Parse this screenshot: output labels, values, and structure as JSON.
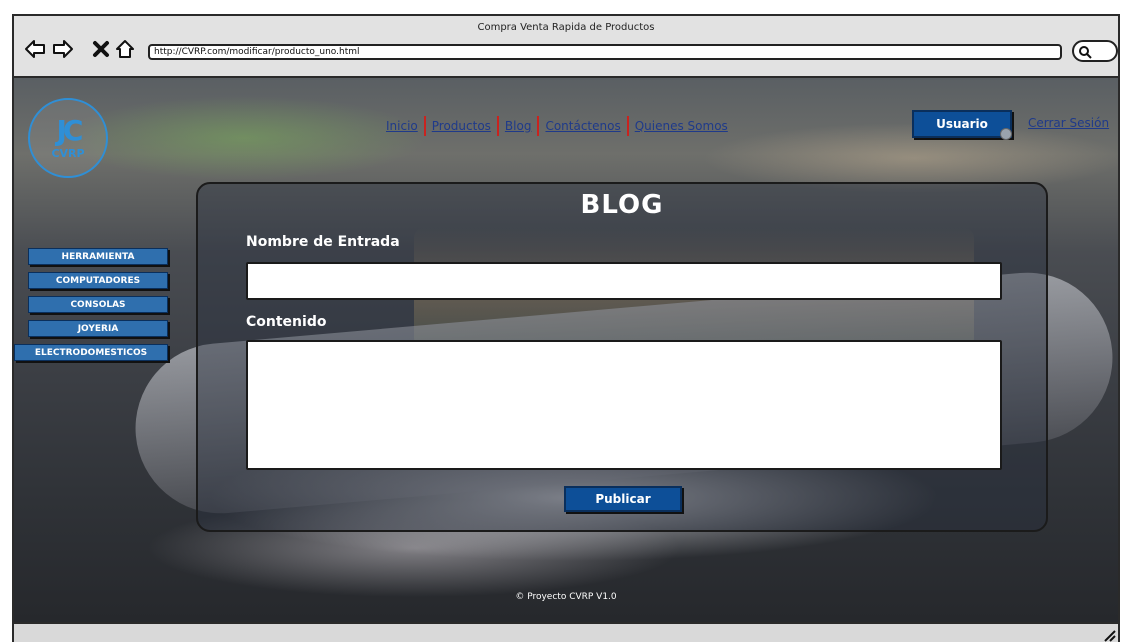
{
  "window": {
    "title": "Compra Venta Rapida de Productos",
    "url": "http://CVRP.com/modificar/producto_uno.html"
  },
  "icons": {
    "back": "arrow-left-icon",
    "forward": "arrow-right-icon",
    "stop": "close-icon",
    "home": "home-icon",
    "search": "search-icon"
  },
  "logo": {
    "mark": "JC",
    "text": "CVRP"
  },
  "nav": {
    "items": [
      {
        "label": "Inicio"
      },
      {
        "label": "Productos"
      },
      {
        "label": "Blog"
      },
      {
        "label": "Contáctenos"
      },
      {
        "label": "Quienes Somos"
      }
    ]
  },
  "user": {
    "button_label": "Usuario",
    "logout_label": "Cerrar Sesión"
  },
  "sidebar": {
    "items": [
      {
        "label": "HERRAMIENTA"
      },
      {
        "label": "COMPUTADORES"
      },
      {
        "label": "CONSOLAS"
      },
      {
        "label": "JOYERIA"
      },
      {
        "label": "ELECTRODOMESTICOS"
      }
    ]
  },
  "blog": {
    "title": "BLOG",
    "entry_name_label": "Nombre de Entrada",
    "entry_name_value": "",
    "content_label": "Contenido",
    "content_value": "",
    "publish_label": "Publicar"
  },
  "footer": {
    "text": "© Proyecto CVRP V1.0"
  },
  "colors": {
    "primary_button": "#0d4f98",
    "link": "#1f3a8a",
    "nav_separator": "#c9231f",
    "logo": "#2f8fd6"
  }
}
